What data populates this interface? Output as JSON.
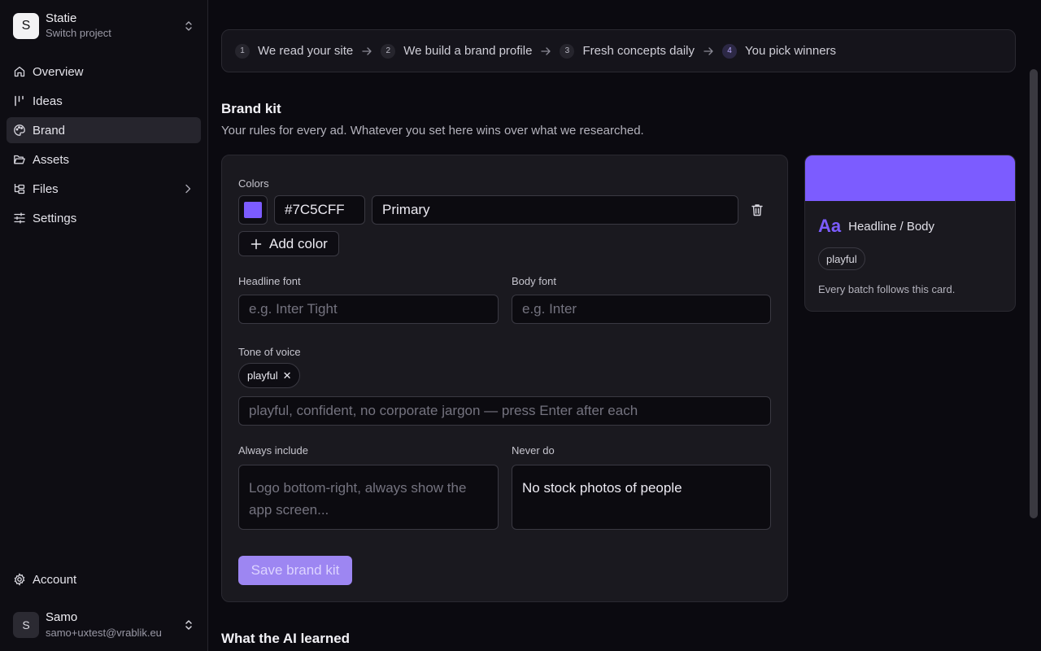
{
  "project": {
    "initial": "S",
    "name": "Statie",
    "subtitle": "Switch project"
  },
  "nav": {
    "overview": "Overview",
    "ideas": "Ideas",
    "brand": "Brand",
    "assets": "Assets",
    "files": "Files",
    "settings": "Settings",
    "account": "Account"
  },
  "user": {
    "initial": "S",
    "name": "Samo",
    "email": "samo+uxtest@vrablik.eu"
  },
  "steps": [
    {
      "num": "1",
      "label": "We read your site"
    },
    {
      "num": "2",
      "label": "We build a brand profile"
    },
    {
      "num": "3",
      "label": "Fresh concepts daily"
    },
    {
      "num": "4",
      "label": "You pick winners"
    }
  ],
  "brand_kit": {
    "title": "Brand kit",
    "subtitle": "Your rules for every ad. Whatever you set here wins over what we researched.",
    "colors_label": "Colors",
    "color_hex": "#7C5CFF",
    "color_name": "Primary",
    "add_color": "Add color",
    "headline_font_label": "Headline font",
    "headline_font_placeholder": "e.g. Inter Tight",
    "body_font_label": "Body font",
    "body_font_placeholder": "e.g. Inter",
    "tone_label": "Tone of voice",
    "tone_chip": "playful",
    "tone_chip_remove": "✕",
    "tone_placeholder": "playful, confident, no corporate jargon — press Enter after each",
    "always_label": "Always include",
    "always_placeholder": "Logo bottom-right, always show the app screen...",
    "never_label": "Never do",
    "never_value": "No stock photos of people",
    "save": "Save brand kit"
  },
  "preview": {
    "aa": "Aa",
    "fonts": "Headline / Body",
    "tone_chip": "playful",
    "note": "Every batch follows this card."
  },
  "learned_title": "What the AI learned",
  "colors": {
    "accent": "#7C5CFF",
    "background": "#0b0a10",
    "card": "#1a191f"
  }
}
